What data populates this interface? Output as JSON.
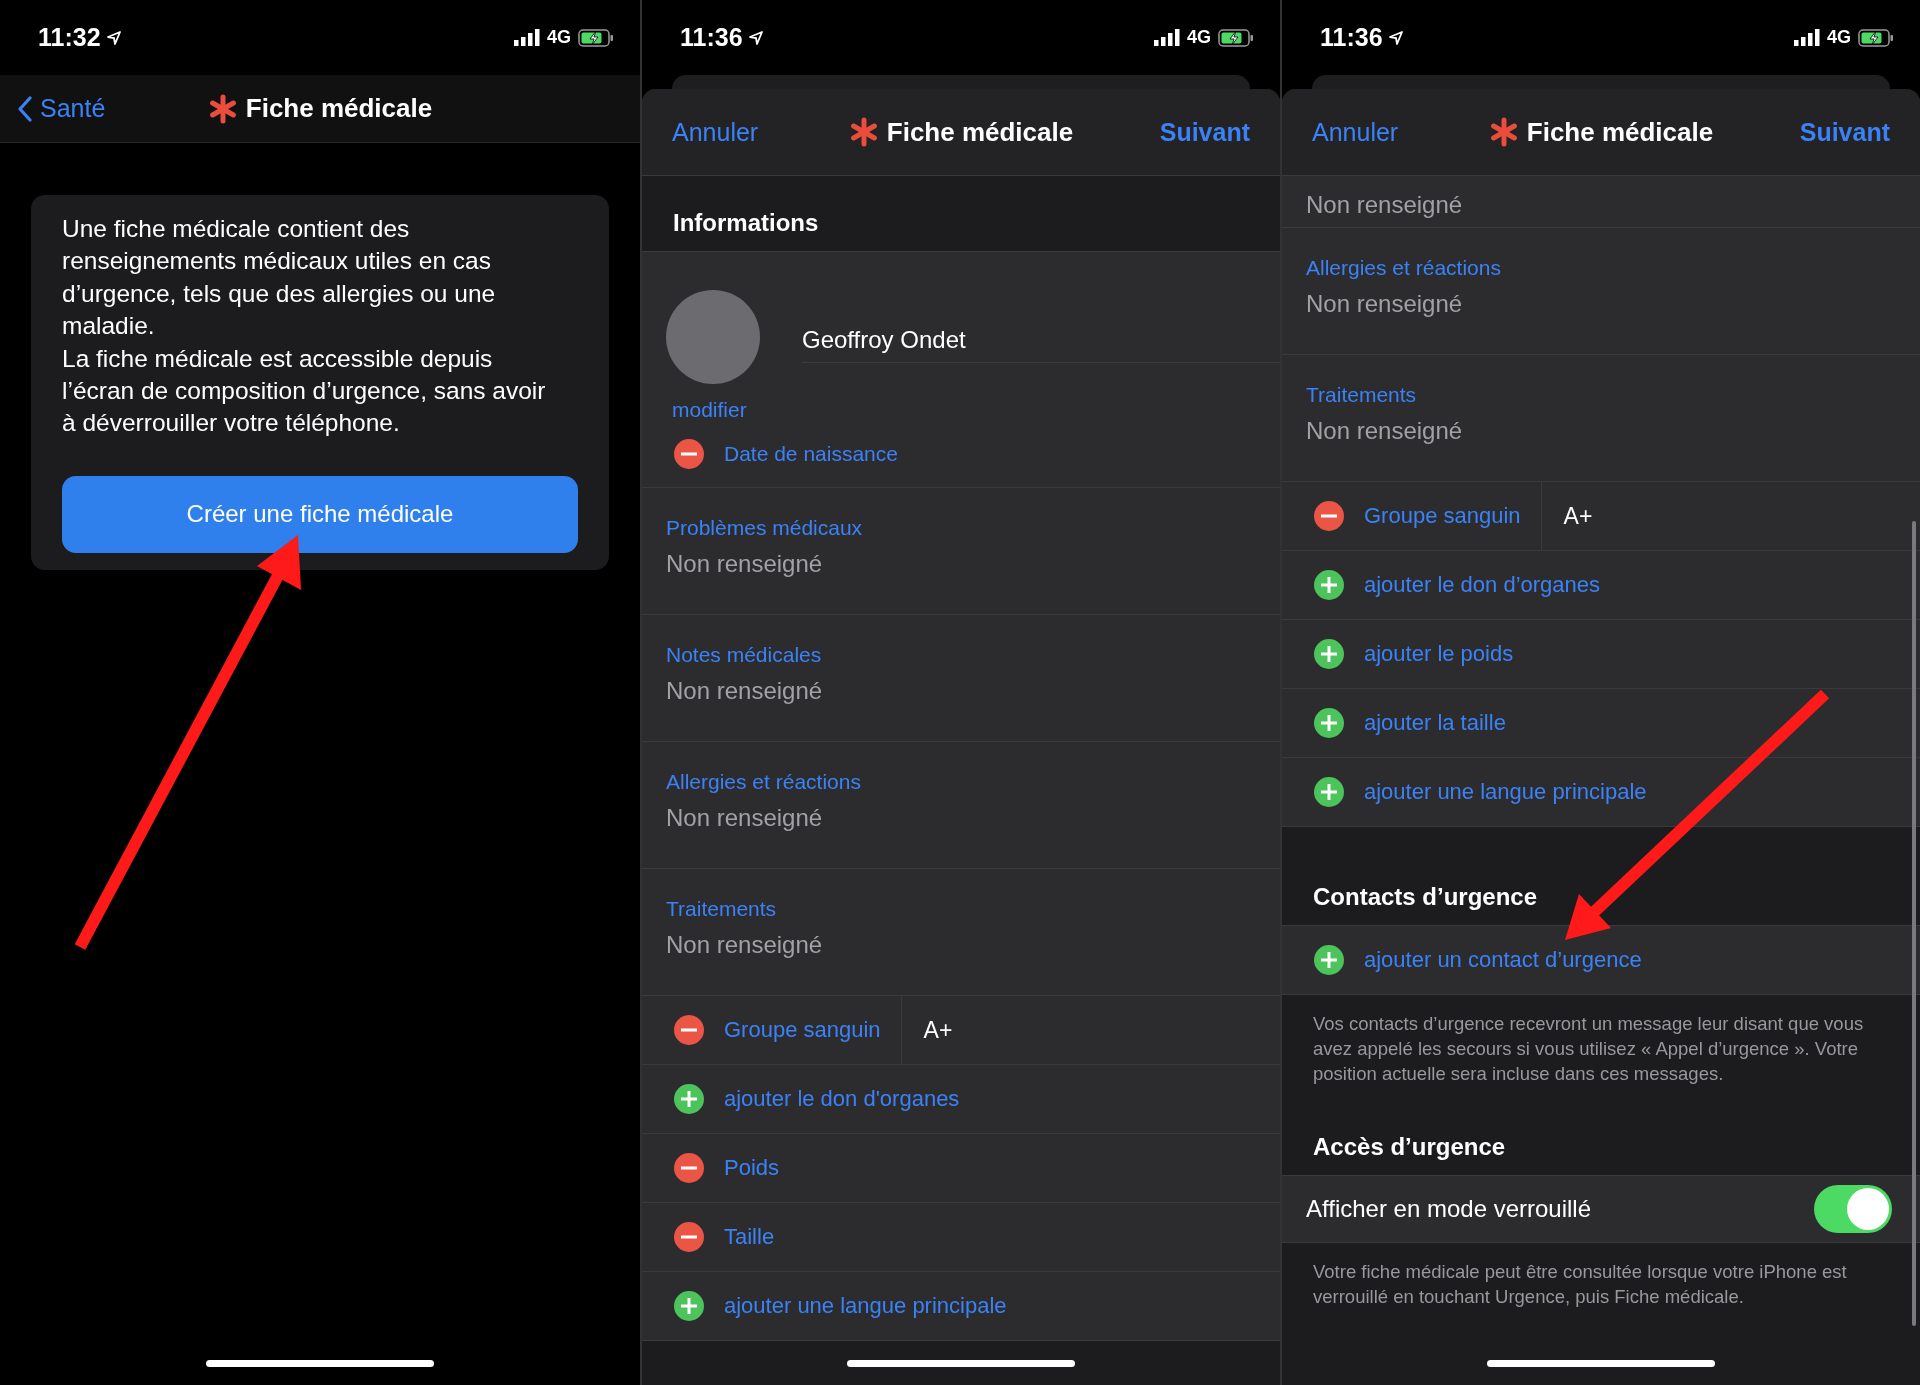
{
  "panels": [
    {
      "kind": "intro",
      "status": {
        "time": "11:32",
        "network": "4G"
      },
      "nav": {
        "back": "Santé",
        "title": "Fiche médicale"
      },
      "card": {
        "paragraphs": [
          "Une fiche médicale contient des renseignements médicaux utiles en cas d’urgence, tels que des allergies ou une maladie.",
          "La fiche médicale est accessible depuis l’écran de composition d’urgence, sans avoir à déverrouiller votre téléphone."
        ],
        "button": "Créer une fiche médicale"
      }
    },
    {
      "kind": "form",
      "status": {
        "time": "11:36",
        "network": "4G"
      },
      "nav": {
        "cancel": "Annuler",
        "title": "Fiche médicale",
        "next": "Suivant"
      },
      "rows": [
        {
          "kind": "header",
          "text": "Informations"
        },
        {
          "kind": "profile",
          "name": "Geoffroy Ondet",
          "edit": "modifier",
          "field": "Date de naissance"
        },
        {
          "kind": "field",
          "label": "Problèmes médicaux",
          "value": "Non renseigné"
        },
        {
          "kind": "field",
          "label": "Notes médicales",
          "value": "Non renseigné"
        },
        {
          "kind": "field",
          "label": "Allergies et réactions",
          "value": "Non renseigné"
        },
        {
          "kind": "field",
          "label": "Traitements",
          "value": "Non renseigné"
        },
        {
          "kind": "remove",
          "label": "Groupe sanguin",
          "value": "A+"
        },
        {
          "kind": "add",
          "label": "ajouter le don d'organes"
        },
        {
          "kind": "remove",
          "label": "Poids"
        },
        {
          "kind": "remove",
          "label": "Taille"
        },
        {
          "kind": "add",
          "label": "ajouter une langue principale"
        }
      ]
    },
    {
      "kind": "form",
      "status": {
        "time": "11:36",
        "network": "4G"
      },
      "nav": {
        "cancel": "Annuler",
        "title": "Fiche médicale",
        "next": "Suivant"
      },
      "scroll_indicator": true,
      "rows": [
        {
          "kind": "value_only",
          "value": "Non renseigné"
        },
        {
          "kind": "field",
          "label": "Allergies et réactions",
          "value": "Non renseigné"
        },
        {
          "kind": "field",
          "label": "Traitements",
          "value": "Non renseigné"
        },
        {
          "kind": "remove",
          "label": "Groupe sanguin",
          "value": "A+"
        },
        {
          "kind": "add",
          "label": "ajouter le don d’organes"
        },
        {
          "kind": "add",
          "label": "ajouter le poids"
        },
        {
          "kind": "add",
          "label": "ajouter la taille"
        },
        {
          "kind": "add",
          "label": "ajouter une langue principale"
        },
        {
          "kind": "header",
          "text": "Contacts d’urgence"
        },
        {
          "kind": "add",
          "label": "ajouter un contact d’urgence"
        },
        {
          "kind": "footer",
          "text": "Vos contacts d’urgence recevront un message leur disant que vous avez appelé les secours si vous utilisez « Appel d’urgence ». Votre position actuelle sera incluse dans ces messages."
        },
        {
          "kind": "header",
          "text": "Accès d’urgence"
        },
        {
          "kind": "toggle",
          "label": "Afficher en mode verrouillé",
          "on": true
        },
        {
          "kind": "footer",
          "text": "Votre fiche médicale peut être consultée lorsque votre iPhone est verrouillé en touchant Urgence, puis Fiche médicale."
        }
      ]
    }
  ]
}
